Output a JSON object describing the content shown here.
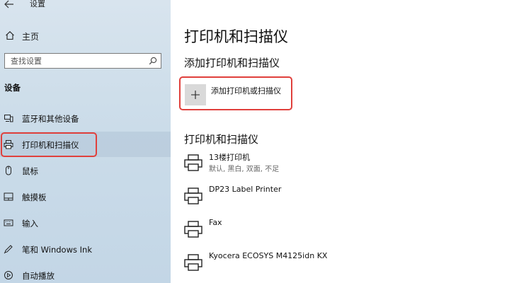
{
  "app": {
    "title": "设置"
  },
  "sidebar": {
    "home_label": "主页",
    "search_placeholder": "查找设置",
    "section_label": "设备",
    "items": [
      {
        "label": "蓝牙和其他设备",
        "icon": "bluetooth-icon"
      },
      {
        "label": "打印机和扫描仪",
        "icon": "printer-icon",
        "active": true
      },
      {
        "label": "鼠标",
        "icon": "mouse-icon"
      },
      {
        "label": "触摸板",
        "icon": "touchpad-icon"
      },
      {
        "label": "输入",
        "icon": "keyboard-icon"
      },
      {
        "label": "笔和 Windows Ink",
        "icon": "pen-icon"
      },
      {
        "label": "自动播放",
        "icon": "autoplay-icon"
      }
    ]
  },
  "main": {
    "title": "打印机和扫描仪",
    "add_section_heading": "添加打印机和扫描仪",
    "add_button_label": "添加打印机或扫描仪",
    "list_heading": "打印机和扫描仪",
    "printers": [
      {
        "name": "13楼打印机",
        "status": "默认, 黑白, 双面, 不足"
      },
      {
        "name": "DP23 Label Printer",
        "status": ""
      },
      {
        "name": "Fax",
        "status": ""
      },
      {
        "name": "Kyocera ECOSYS M4125idn KX",
        "status": ""
      }
    ]
  },
  "colors": {
    "highlight": "#e0403c",
    "sidebar_bg": "#cbdce9",
    "add_icon_bg": "#d9d9d9"
  }
}
